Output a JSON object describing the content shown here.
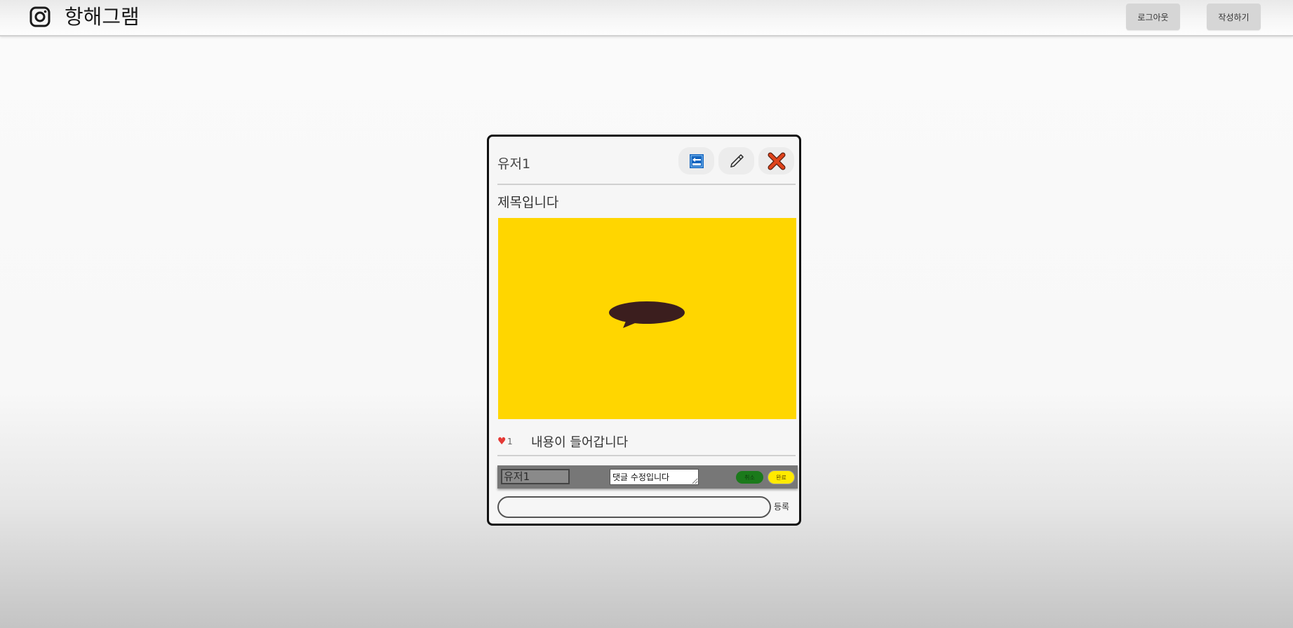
{
  "header": {
    "logo_icon": "instagram-icon",
    "brand": "항해그램",
    "logout_label": "로그아웃",
    "write_label": "작성하기"
  },
  "post": {
    "author": "유저1",
    "actions": {
      "back_icon": "back-icon",
      "edit_icon": "pencil-icon",
      "delete_icon": "close-icon"
    },
    "title": "제목입니다",
    "image_icon": "speech-bubble-icon",
    "image_color": "#ffd600",
    "like_icon": "heart-icon",
    "likes": "1",
    "content": "내용이 들어갑니다"
  },
  "comments": [
    {
      "author": "유저1",
      "edit_value": "댓글 수정입니다",
      "cancel_label": "취소",
      "done_label": "완료"
    }
  ],
  "comment_form": {
    "placeholder": "",
    "submit_label": "등록"
  }
}
